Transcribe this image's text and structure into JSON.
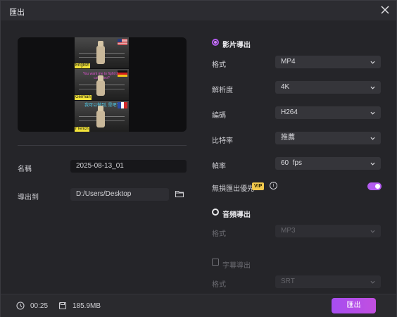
{
  "window": {
    "title": "匯出"
  },
  "preview": {
    "captions": [
      "English",
      "German",
      "French"
    ],
    "subtitle_lines": [
      "You want me to fight the",
      "colosseo?",
      "我可以做到, 是吧?"
    ]
  },
  "left": {
    "name_label": "名稱",
    "name_value": "2025-08-13_01",
    "export_to_label": "導出到",
    "export_to_value": "D:/Users/Desktop"
  },
  "video_section": {
    "title": "影片導出",
    "rows": [
      {
        "label": "格式",
        "value": "MP4"
      },
      {
        "label": "解析度",
        "value": "4K"
      },
      {
        "label": "編碼",
        "value": "H264"
      },
      {
        "label": "比特率",
        "value": "推薦"
      },
      {
        "label": "幀率",
        "value": "60  fps"
      }
    ],
    "lossless_label": "無損匯出優先",
    "vip_badge": "VIP",
    "info_glyph": "i",
    "lossless_enabled": true
  },
  "audio_section": {
    "title": "音頻導出",
    "format_label": "格式",
    "format_value": "MP3"
  },
  "subtitle_section": {
    "title": "字幕導出",
    "format_label": "格式",
    "format_value": "SRT"
  },
  "footer": {
    "duration": "00:25",
    "size": "185.9MB",
    "export_button": "匯出"
  },
  "colors": {
    "accent": "#b45cf0",
    "background": "#252529",
    "vip": "#f2c94c"
  }
}
